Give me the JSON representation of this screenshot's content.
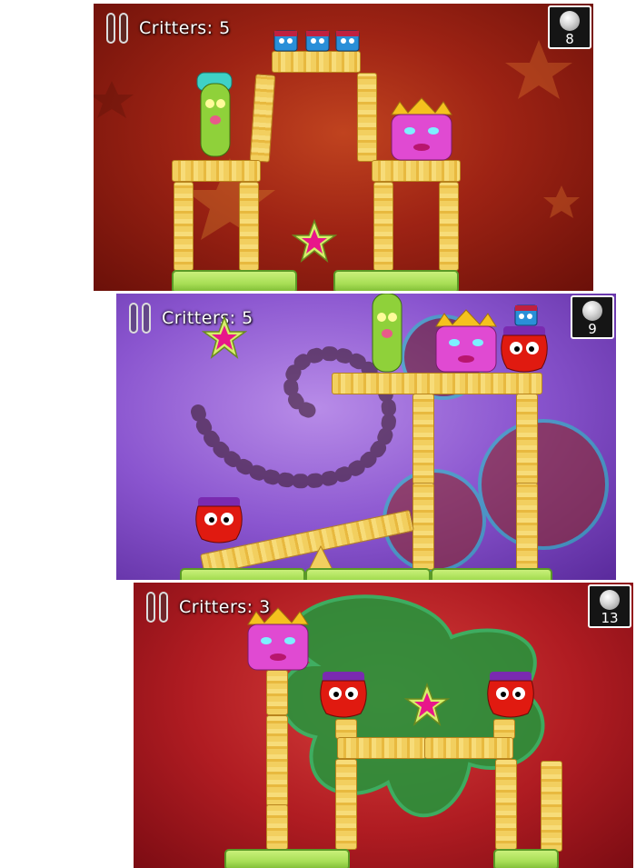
{
  "screens": [
    {
      "critters_label": "Critters: 5",
      "coin_count": "8",
      "background": "red-stars"
    },
    {
      "critters_label": "Critters: 5",
      "coin_count": "9",
      "background": "purple-swirl"
    },
    {
      "critters_label": "Critters: 3",
      "coin_count": "13",
      "background": "red-green-splat"
    }
  ],
  "colors": {
    "wood": "#f2cf5f",
    "ground": "#a7de55",
    "star_fill": "#e8168a",
    "star_outline": "#d7f06a",
    "green_critter": "#8fd13a",
    "pink_critter": "#e04ad2",
    "red_critter": "#e01a10",
    "blue_critter": "#2a8fd8"
  },
  "icons": [
    "pause-icon",
    "coin-icon",
    "star-icon"
  ]
}
